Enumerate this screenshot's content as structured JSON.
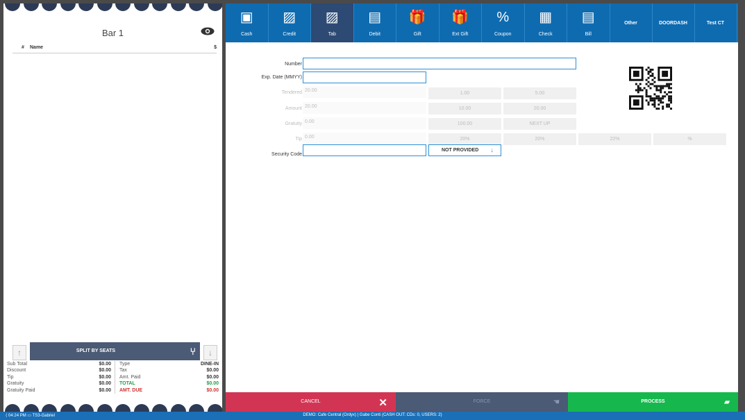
{
  "receipt": {
    "title": "Bar 1",
    "col_num": "#",
    "col_name": "Name",
    "col_price": "$",
    "split_label": "SPLIT BY SEATS",
    "left_totals": [
      {
        "label": "Sub Total",
        "value": "$0.00"
      },
      {
        "label": "Discount",
        "value": "$0.00"
      },
      {
        "label": "Tip",
        "value": "$0.00"
      },
      {
        "label": "Gratuity",
        "value": "$0.00"
      },
      {
        "label": "Gratuity Paid",
        "value": "$0.00"
      }
    ],
    "right_totals": [
      {
        "label": "Type",
        "value": "DINE-IN"
      },
      {
        "label": "Tax",
        "value": "$0.00"
      },
      {
        "label": "Amt. Paid",
        "value": "$0.00"
      },
      {
        "label": "TOTAL",
        "value": "$0.00"
      },
      {
        "label": "AMT. DUE",
        "value": "$0.00"
      }
    ]
  },
  "tabs": [
    {
      "label": "Cash",
      "icon": "cash-icon"
    },
    {
      "label": "Credit",
      "icon": "credit-card-icon"
    },
    {
      "label": "Tab",
      "icon": "tab-card-icon",
      "active": true
    },
    {
      "label": "Debit",
      "icon": "debit-card-icon"
    },
    {
      "label": "Gift",
      "icon": "gift-icon"
    },
    {
      "label": "Ext Gift",
      "icon": "ext-gift-icon"
    },
    {
      "label": "Coupon",
      "icon": "coupon-icon"
    },
    {
      "label": "Check",
      "icon": "check-icon"
    },
    {
      "label": "Bill",
      "icon": "bill-icon"
    },
    {
      "label": "Other"
    },
    {
      "label": "DOORDASH"
    },
    {
      "label": "Test CT"
    }
  ],
  "form": {
    "number_label": "Number",
    "exp_label": "Exp. Date (MMYY)",
    "tendered_label": "Tendered",
    "tendered_value": "20.00",
    "amount_label": "Amount",
    "amount_value": "20.00",
    "gratuity_label": "Gratuity",
    "gratuity_value": "0.00",
    "tip_label": "Tip",
    "tip_value": "0.00",
    "security_label": "Security Code",
    "not_provided": "NOT PROVIDED",
    "quick_tendered": [
      "1.00",
      "5.00"
    ],
    "quick_amount": [
      "10.00",
      "20.00"
    ],
    "quick_gratuity": [
      "100.00",
      "NEXT UP"
    ],
    "quick_tip": [
      "20%",
      "20%",
      "22%",
      "%"
    ]
  },
  "actions": {
    "cancel": "CANCEL",
    "force": "FORCE",
    "process": "PROCESS"
  },
  "status": {
    "time": "04:24 PM",
    "terminal": "TS3-Gabriel",
    "center": "DEMO: Cafe Central (Ordyx) | Gabe Conti (CASH OUT: CDs: 0, USERS: 2)"
  },
  "colors": {
    "tab_bar": "#0e6bb0",
    "tab_active": "#2c4a73",
    "cancel": "#d23553",
    "process": "#16b84e",
    "force": "#4b5a75"
  }
}
